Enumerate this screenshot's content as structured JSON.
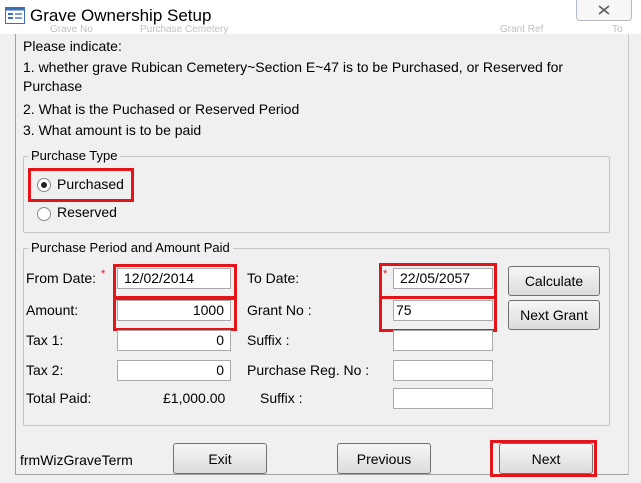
{
  "window": {
    "title": "Grave Ownership Setup",
    "ghost_header": [
      "Grave No",
      "Purchase Cemetery",
      "Grant Ref",
      "To"
    ]
  },
  "instructions": {
    "heading": "Please indicate:",
    "line1a": "1. whether grave Rubican Cemetery~Section E~47 is to be Purchased, or Reserved for",
    "line1b": "Purchase",
    "line2": "2. What is the Puchased or Reserved Period",
    "line3": "3.  What amount is to be paid"
  },
  "purchase_type": {
    "legend": "Purchase Type",
    "options": [
      {
        "label": "Purchased",
        "selected": true
      },
      {
        "label": "Reserved",
        "selected": false
      }
    ]
  },
  "period": {
    "legend": "Purchase Period and Amount Paid",
    "from_date_label": "From Date:",
    "from_date_required": "*",
    "from_date": "12/02/2014",
    "to_date_label": "To Date:",
    "to_date_required": "*",
    "to_date": "22/05/2057",
    "amount_label": "Amount:",
    "amount": "1000",
    "grant_no_label": "Grant No :",
    "grant_no": "75",
    "tax1_label": "Tax 1:",
    "tax1": "0",
    "suffix1_label": "Suffix :",
    "suffix1": "",
    "tax2_label": "Tax 2:",
    "tax2": "0",
    "purchase_reg_label": "Purchase Reg. No :",
    "purchase_reg": "",
    "total_paid_label": "Total Paid:",
    "total_paid": "£1,000.00",
    "suffix2_label": "Suffix :",
    "suffix2": "",
    "calculate_label": "Calculate",
    "next_grant_label": "Next Grant"
  },
  "footer": {
    "form_name": "frmWizGraveTerm",
    "exit_label": "Exit",
    "previous_label": "Previous",
    "next_label": "Next"
  },
  "colors": {
    "highlight": "#e4141b",
    "window_bg": "#f0f0f0"
  }
}
